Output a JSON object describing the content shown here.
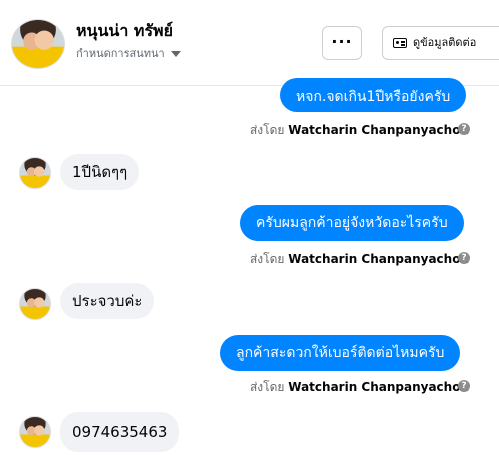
{
  "header": {
    "name": "หนุนน่า ทรัพย์",
    "subtitle": "กำหนดการสนทนา",
    "more_label": "···",
    "info_label": "ดูข้อมูลติดต่อ"
  },
  "messages": {
    "m1": {
      "text": "หจก.จดเกิน1ปีหรือยังครับ"
    },
    "s1": {
      "prefix": "ส่งโดย",
      "sender": "Watcharin Chanpanyachon",
      "help": "?"
    },
    "m2": {
      "text": "1ปีนิดๆๆ"
    },
    "m3": {
      "text": "ครับผมลูกค้าอยู่จังหวัดอะไรครับ"
    },
    "s2": {
      "prefix": "ส่งโดย",
      "sender": "Watcharin Chanpanyachon",
      "help": "?"
    },
    "m4": {
      "text": "ประจวบค่ะ"
    },
    "m5": {
      "text": "ลูกค้าสะดวกให้เบอร์ติดต่อไหมครับ"
    },
    "s3": {
      "prefix": "ส่งโดย",
      "sender": "Watcharin Chanpanyachon",
      "help": "?"
    },
    "m6": {
      "text": "0974635463"
    }
  },
  "colors": {
    "outgoing_bubble": "#0084ff",
    "incoming_bubble": "#f0f2f5"
  }
}
